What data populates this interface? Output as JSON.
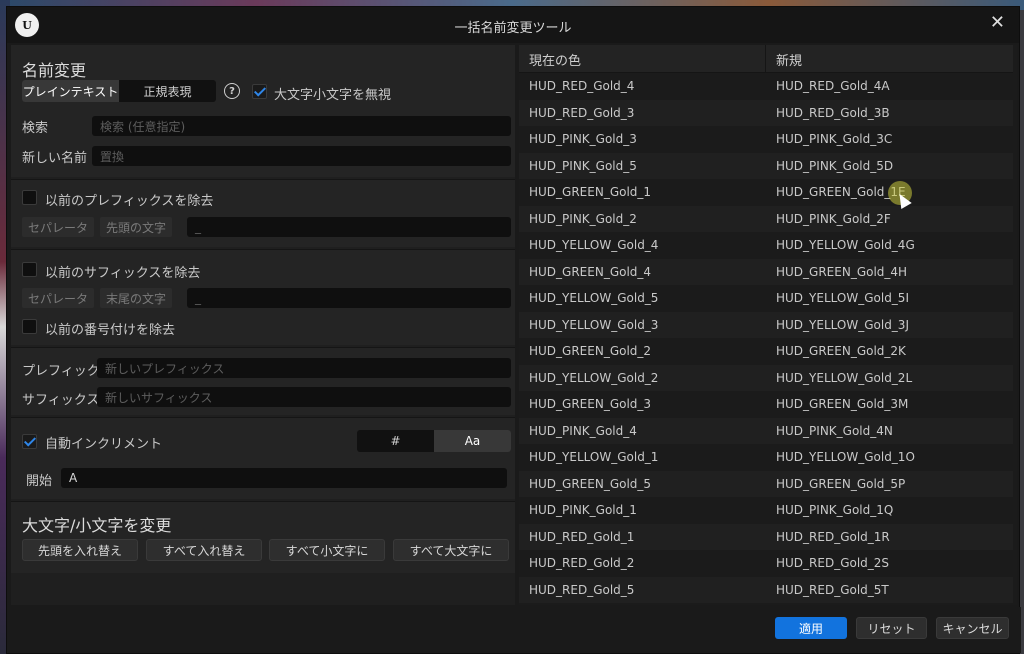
{
  "window": {
    "title": "一括名前変更ツール"
  },
  "rename": {
    "title": "名前変更",
    "mode_plain": "プレインテキスト",
    "mode_regex": "正規表現",
    "ignore_case_label": "大文字小文字を無視",
    "ignore_case_checked": true,
    "search_label": "検索",
    "search_placeholder": "検索 (任意指定)",
    "new_name_label": "新しい名前",
    "new_name_placeholder": "置換"
  },
  "prefix_remove": {
    "label": "以前のプレフィックスを除去",
    "separator_tag": "セパレータ",
    "position_tag": "先頭の文字",
    "value": "_"
  },
  "suffix_remove": {
    "label": "以前のサフィックスを除去",
    "separator_tag": "セパレータ",
    "position_tag": "末尾の文字",
    "value": "_",
    "numbering_label": "以前の番号付けを除去"
  },
  "affix": {
    "prefix_label": "プレフィック.",
    "prefix_placeholder": "新しいプレフィックス",
    "suffix_label": "サフィックス",
    "suffix_placeholder": "新しいサフィックス"
  },
  "increment": {
    "label": "自動インクリメント",
    "checked": true,
    "mode_hash": "#",
    "mode_alpha": "Aa",
    "start_label": "開始",
    "start_value": "A"
  },
  "case_change": {
    "title": "大文字/小文字を変更",
    "btn_capitalize": "先頭を入れ替え",
    "btn_swap": "すべて入れ替え",
    "btn_lower": "すべて小文字に",
    "btn_upper": "すべて大文字に"
  },
  "table": {
    "col_current": "現在の色",
    "col_new": "新規",
    "rows": [
      [
        "HUD_RED_Gold_4",
        "HUD_RED_Gold_4A"
      ],
      [
        "HUD_RED_Gold_3",
        "HUD_RED_Gold_3B"
      ],
      [
        "HUD_PINK_Gold_3",
        "HUD_PINK_Gold_3C"
      ],
      [
        "HUD_PINK_Gold_5",
        "HUD_PINK_Gold_5D"
      ],
      [
        "HUD_GREEN_Gold_1",
        "HUD_GREEN_Gold_1E"
      ],
      [
        "HUD_PINK_Gold_2",
        "HUD_PINK_Gold_2F"
      ],
      [
        "HUD_YELLOW_Gold_4",
        "HUD_YELLOW_Gold_4G"
      ],
      [
        "HUD_GREEN_Gold_4",
        "HUD_GREEN_Gold_4H"
      ],
      [
        "HUD_YELLOW_Gold_5",
        "HUD_YELLOW_Gold_5I"
      ],
      [
        "HUD_YELLOW_Gold_3",
        "HUD_YELLOW_Gold_3J"
      ],
      [
        "HUD_GREEN_Gold_2",
        "HUD_GREEN_Gold_2K"
      ],
      [
        "HUD_YELLOW_Gold_2",
        "HUD_YELLOW_Gold_2L"
      ],
      [
        "HUD_GREEN_Gold_3",
        "HUD_GREEN_Gold_3M"
      ],
      [
        "HUD_PINK_Gold_4",
        "HUD_PINK_Gold_4N"
      ],
      [
        "HUD_YELLOW_Gold_1",
        "HUD_YELLOW_Gold_1O"
      ],
      [
        "HUD_GREEN_Gold_5",
        "HUD_GREEN_Gold_5P"
      ],
      [
        "HUD_PINK_Gold_1",
        "HUD_PINK_Gold_1Q"
      ],
      [
        "HUD_RED_Gold_1",
        "HUD_RED_Gold_1R"
      ],
      [
        "HUD_RED_Gold_2",
        "HUD_RED_Gold_2S"
      ],
      [
        "HUD_RED_Gold_5",
        "HUD_RED_Gold_5T"
      ]
    ]
  },
  "footer": {
    "apply": "適用",
    "reset": "リセット",
    "cancel": "キャンセル"
  },
  "colors": {
    "accent": "#1273de",
    "check": "#2f86e8"
  }
}
